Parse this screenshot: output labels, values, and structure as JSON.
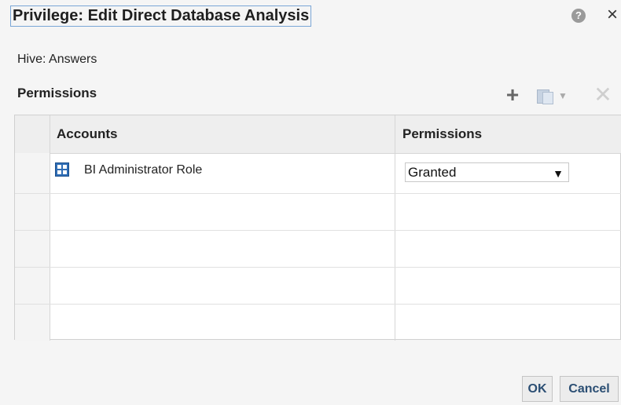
{
  "dialog": {
    "title": "Privilege: Edit Direct Database Analysis",
    "help_symbol": "?",
    "close_symbol": "×"
  },
  "hive": "Hive: Answers",
  "permissions_section": {
    "title": "Permissions",
    "toolbar": {
      "add_symbol": "+",
      "assign_caret": "▼",
      "delete_symbol": "✕"
    }
  },
  "table": {
    "headers": {
      "accounts": "Accounts",
      "permissions": "Permissions"
    },
    "rows": [
      {
        "account": "BI Administrator Role",
        "account_icon": "role-icon",
        "permission": "Granted"
      }
    ]
  },
  "buttons": {
    "ok": "OK",
    "cancel": "Cancel"
  },
  "colors": {
    "button_text": "#2b4e73",
    "title_border": "#7aa6d6",
    "role_icon": "#2f6db5"
  }
}
